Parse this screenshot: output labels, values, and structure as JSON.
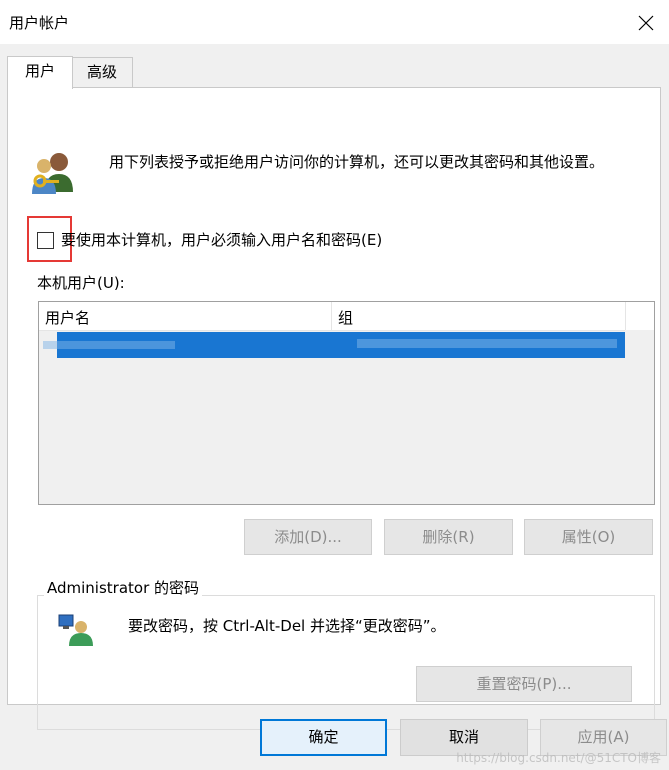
{
  "window": {
    "title": "用户帐户"
  },
  "tabs": [
    {
      "label": "用户"
    },
    {
      "label": "高级"
    }
  ],
  "intro": "用下列表授予或拒绝用户访问你的计算机，还可以更改其密码和其他设置。",
  "require_login": {
    "label": "要使用本计算机，用户必须输入用户名和密码(E)",
    "checked": false
  },
  "local_users": {
    "label": "本机用户(U):",
    "columns": [
      "用户名",
      "组"
    ]
  },
  "user_buttons": {
    "add": "添加(D)...",
    "remove": "删除(R)",
    "properties": "属性(O)"
  },
  "password_group": {
    "title": "Administrator 的密码",
    "text": "要改密码，按 Ctrl-Alt-Del 并选择“更改密码”。",
    "reset_button": "重置密码(P)..."
  },
  "footer": {
    "ok": "确定",
    "cancel": "取消",
    "apply": "应用(A)"
  },
  "watermark": "https://blog.csdn.net/@51CTO博客",
  "colors": {
    "selection": "#1976d2",
    "highlight_box": "#e53935"
  }
}
